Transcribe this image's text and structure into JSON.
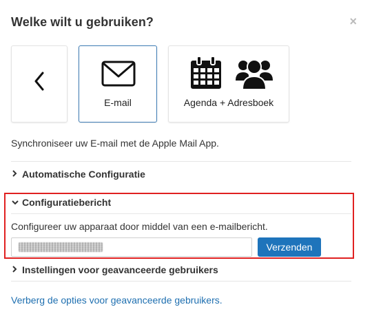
{
  "dialog": {
    "title": "Welke wilt u gebruiken?",
    "close_label": "×"
  },
  "cards": {
    "back_icon": "chevron-left-icon",
    "email": {
      "label": "E-mail",
      "icon": "envelope-icon",
      "selected": true
    },
    "agenda": {
      "label": "Agenda + Adresboek",
      "icons": [
        "calendar-icon",
        "users-icon"
      ]
    }
  },
  "description": "Synchroniseer uw E-mail met de Apple Mail App.",
  "sections": {
    "auto": {
      "label": "Automatische Configuratie",
      "expanded": false
    },
    "config": {
      "label": "Configuratiebericht",
      "expanded": true,
      "text": "Configureer uw apparaat door middel van een e-mailbericht.",
      "send_label": "Verzenden"
    },
    "advanced": {
      "label": "Instellingen voor geavanceerde gebruikers",
      "expanded": false
    }
  },
  "hide_link": "Verberg de opties voor geavanceerde gebruikers.",
  "colors": {
    "accent": "#1e74bb",
    "link": "#1e6fb0",
    "highlight_border": "#e02020",
    "selected_card_border": "#3c7ab3"
  }
}
